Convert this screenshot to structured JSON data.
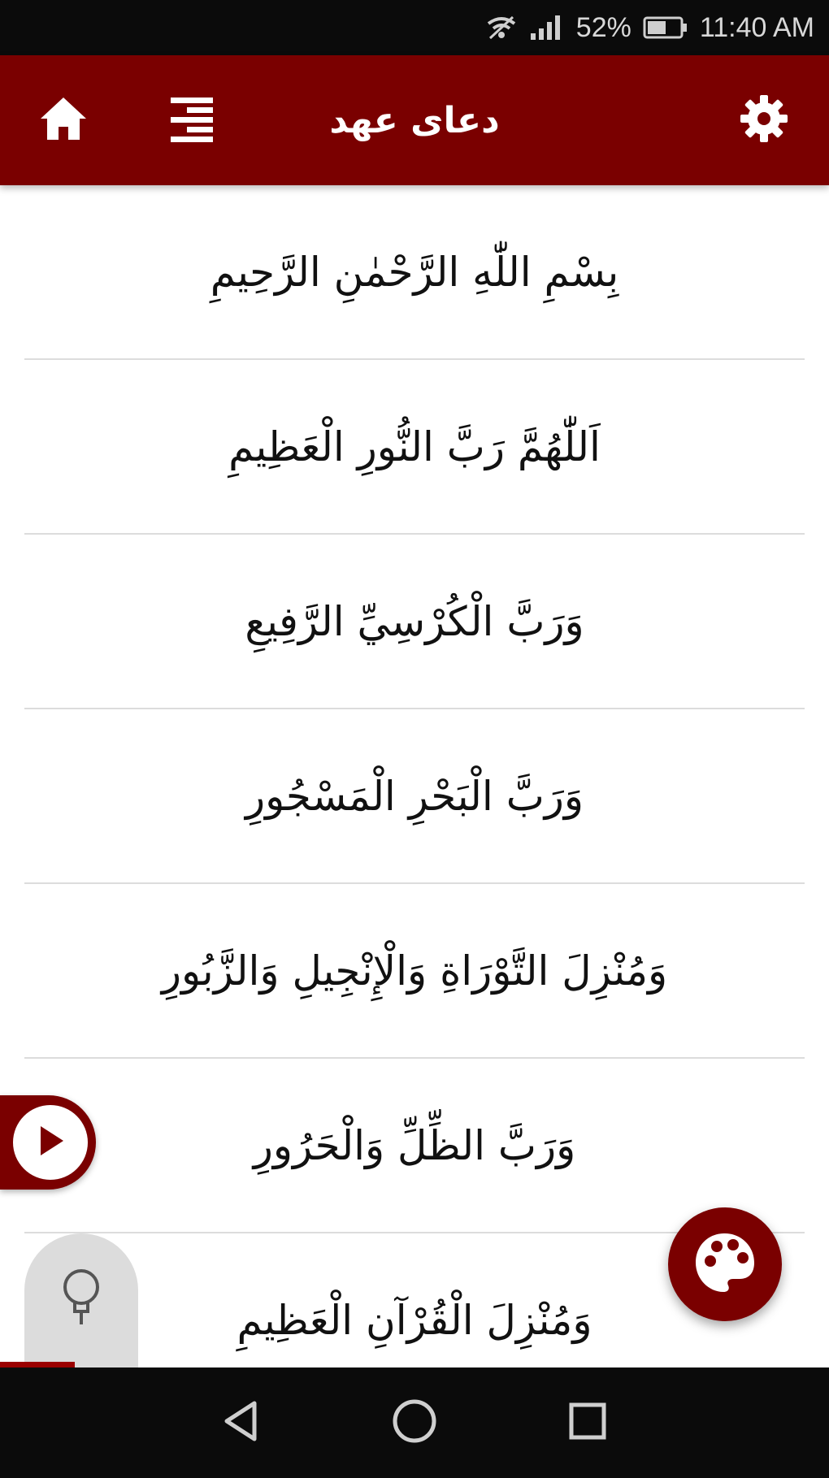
{
  "status_bar": {
    "battery": "52%",
    "time": "11:40 AM"
  },
  "app_bar": {
    "title": "دعای عهد",
    "icons": [
      "home-icon",
      "menu-icon",
      "gear-icon"
    ]
  },
  "verses": [
    "بِسْمِ اللّٰهِ الرَّحْمٰنِ الرَّحِيمِ",
    "اَللّٰهُمَّ رَبَّ النُّورِ الْعَظِيمِ",
    "وَرَبَّ الْكُرْسِيِّ الرَّفِيعِ",
    "وَرَبَّ الْبَحْرِ الْمَسْجُورِ",
    "وَمُنْزِلَ التَّوْرَاةِ وَالْإِنْجِيلِ وَالزَّبُورِ",
    "وَرَبَّ الظِّلِّ وَالْحَرُورِ",
    "وَمُنْزِلَ الْقُرْآنِ الْعَظِيمِ"
  ],
  "colors": {
    "primary": "#7a0000",
    "status_bar": "#0b0b0b",
    "divider": "#dcdcdc"
  },
  "floating_icons": [
    "play-icon",
    "bulb-icon",
    "palette-icon"
  ]
}
